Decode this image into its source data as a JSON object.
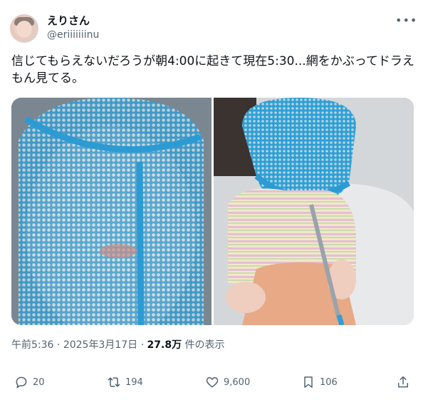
{
  "user": {
    "display_name": "えりさん",
    "handle": "@eriiiiiiinu",
    "avatar_icon": "avatar-photo"
  },
  "more_icon": "more-horizontal-icon",
  "tweet": {
    "text": "信じてもらえないだろうが朝4:00に起きて現在5:30...網をかぶってドラえもん見てる。"
  },
  "media": [
    {
      "description_icon": "photo-child-mesh-closeup"
    },
    {
      "description_icon": "photo-child-mesh-sitting"
    }
  ],
  "meta": {
    "time": "午前5:36",
    "separator": "·",
    "date": "2025年3月17日",
    "views_count": "27.8万",
    "views_label": "件の表示"
  },
  "actions": {
    "reply_count": "20",
    "retweet_count": "194",
    "like_count": "9,600",
    "bookmark_count": "106"
  },
  "colors": {
    "text_primary": "#0f1419",
    "text_secondary": "#536471",
    "mesh_blue": "#3aa8d8"
  }
}
